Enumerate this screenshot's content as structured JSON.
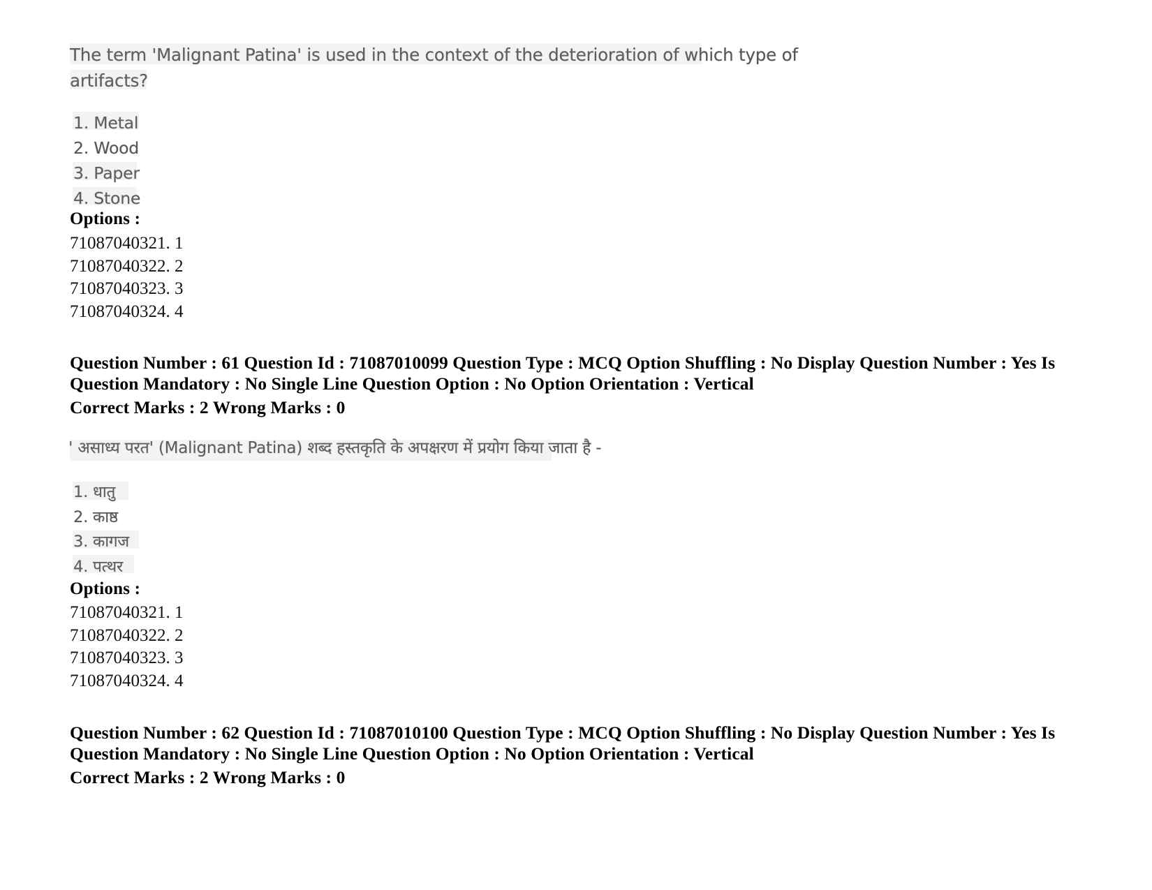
{
  "document": {
    "type": "exam-question-paper",
    "page_background": "#ffffff"
  },
  "question_61": {
    "question_text_line1": "The term 'Malignant Patina' is used in the context of the deterioration of which type of",
    "question_text_line2": "artifacts?",
    "choices": [
      "1. Metal",
      "2. Wood",
      "3. Paper",
      "4. Stone"
    ],
    "options_label": "Options :",
    "option_ids": [
      "71087040321. 1",
      "71087040322. 2",
      "71087040323. 3",
      "71087040324. 4"
    ],
    "meta_line1": "Question Number : 61 Question Id : 71087010099 Question Type : MCQ Option Shuffling : No Display Question Number : Yes Is",
    "meta_line2": "Question Mandatory : No Single Line Question Option : No Option Orientation : Vertical",
    "meta_line3": "Correct Marks : 2 Wrong Marks : 0",
    "meta_fields": {
      "question_number": "61",
      "question_id": "71087010099",
      "question_type": "MCQ",
      "option_shuffling": "No",
      "display_question_number": "Yes",
      "is_question_mandatory": "No",
      "single_line_question_option": "No",
      "option_orientation": "Vertical",
      "correct_marks": "2",
      "wrong_marks": "0"
    }
  },
  "question_62": {
    "question_text_line1": "' असाध्य परत' (Malignant Patina) शब्द हस्तकृति के अपक्षरण में प्रयोग किया जाता है -",
    "choices": [
      "1. धातु",
      "2. काष्ठ",
      "3. कागज",
      "4. पत्थर"
    ],
    "options_label": "Options :",
    "option_ids": [
      "71087040321. 1",
      "71087040322. 2",
      "71087040323. 3",
      "71087040324. 4"
    ],
    "meta_line1": "Question Number : 62 Question Id : 71087010100 Question Type : MCQ Option Shuffling : No Display Question Number : Yes Is",
    "meta_line2": "Question Mandatory : No Single Line Question Option : No Option Orientation : Vertical",
    "meta_line3": "Correct Marks : 2 Wrong Marks : 0",
    "meta_fields": {
      "question_number": "62",
      "question_id": "71087010100",
      "question_type": "MCQ",
      "option_shuffling": "No",
      "display_question_number": "Yes",
      "is_question_mandatory": "No",
      "single_line_question_option": "No",
      "option_orientation": "Vertical",
      "correct_marks": "2",
      "wrong_marks": "0"
    }
  }
}
